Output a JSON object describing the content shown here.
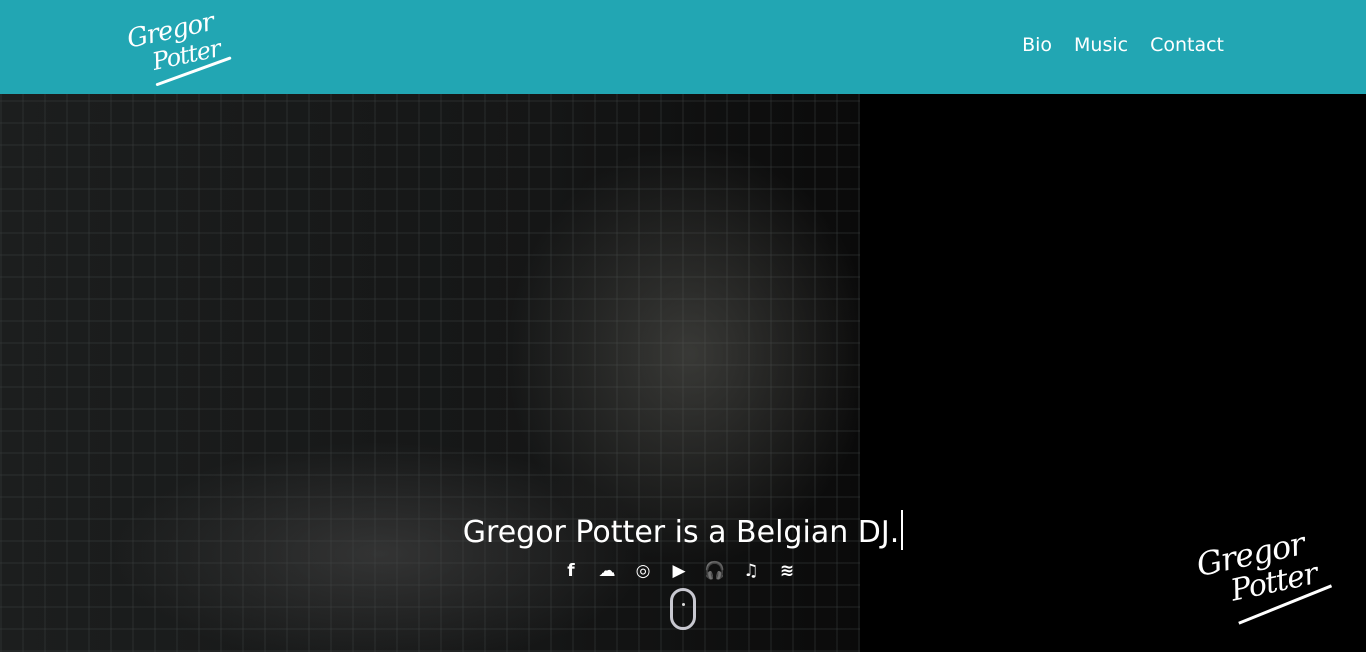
{
  "header": {
    "logo": "Gregor Potter",
    "logo_line1": "Gregor",
    "logo_line2": "Potter",
    "nav": [
      "Bio",
      "Music",
      "Contact"
    ]
  },
  "hero": {
    "tagline": "Gregor Potter is a Belgian DJ.",
    "social": [
      {
        "name": "facebook-icon",
        "glyph": "f"
      },
      {
        "name": "soundcloud-icon",
        "glyph": "☁"
      },
      {
        "name": "instagram-icon",
        "glyph": "◎"
      },
      {
        "name": "youtube-icon",
        "glyph": "▶"
      },
      {
        "name": "headphones-icon",
        "glyph": "🎧"
      },
      {
        "name": "itunes-icon",
        "glyph": "♫"
      },
      {
        "name": "spotify-icon",
        "glyph": "≋"
      }
    ]
  },
  "colors": {
    "header": "#22a6b3"
  }
}
